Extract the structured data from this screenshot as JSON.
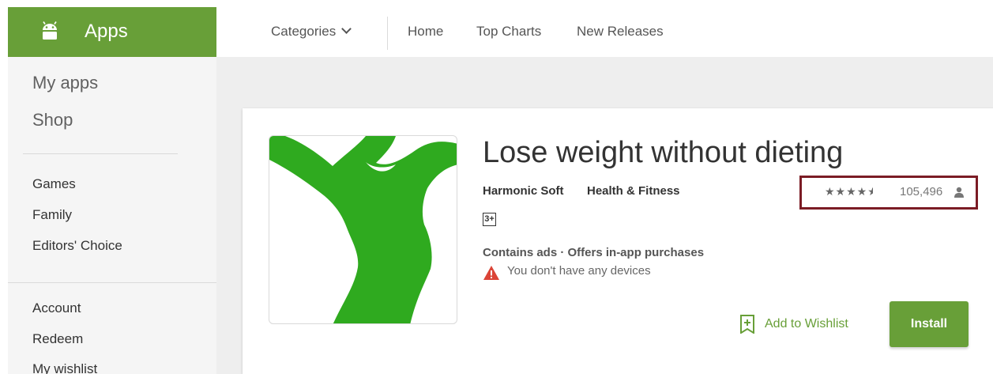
{
  "sidebar": {
    "header_label": "Apps",
    "header_icon": "android-icon",
    "primary": [
      {
        "label": "My apps"
      },
      {
        "label": "Shop"
      }
    ],
    "categories": [
      {
        "label": "Games"
      },
      {
        "label": "Family"
      },
      {
        "label": "Editors' Choice"
      }
    ],
    "account": [
      {
        "label": "Account"
      },
      {
        "label": "Redeem"
      },
      {
        "label": "My wishlist"
      }
    ]
  },
  "topnav": {
    "categories_label": "Categories",
    "home_label": "Home",
    "top_charts_label": "Top Charts",
    "new_releases_label": "New Releases"
  },
  "app": {
    "title": "Lose weight without dieting",
    "developer": "Harmonic Soft",
    "category": "Health & Fitness",
    "rating_stars": 4.5,
    "rating_count": "105,496",
    "content_rating": "3+",
    "ads_note": "Contains ads · Offers in-app purchases",
    "devices_note": "You don't have any devices",
    "wishlist_label": "Add to Wishlist",
    "install_label": "Install"
  },
  "colors": {
    "brand_green": "#689f38",
    "highlight_box": "#7b1c25",
    "warning_red": "#db4437",
    "icon_green": "#2faa1f"
  }
}
